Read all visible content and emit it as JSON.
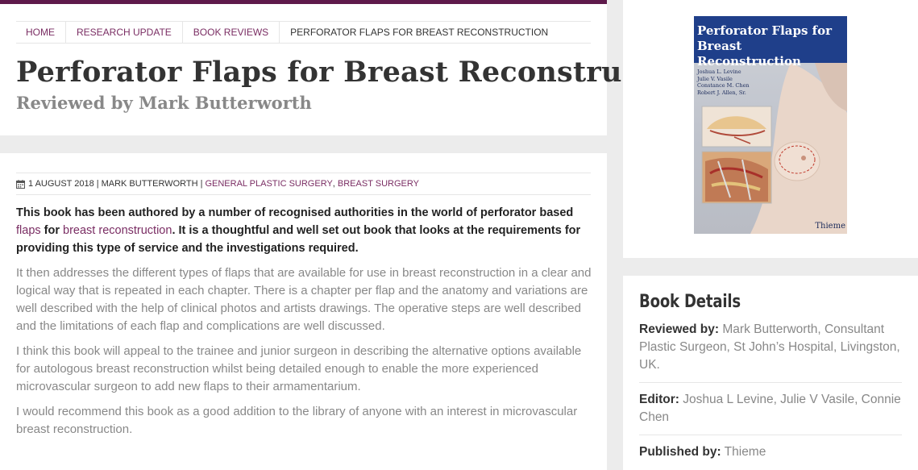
{
  "breadcrumb": {
    "items": [
      "HOME",
      "RESEARCH UPDATE",
      "BOOK REVIEWS"
    ],
    "current": "PERFORATOR FLAPS FOR BREAST RECONSTRUCTION"
  },
  "header": {
    "title": "Perforator Flaps for Breast Reconstruction",
    "subtitle": "Reviewed by Mark Butterworth"
  },
  "meta": {
    "icon": "calendar-icon",
    "date": "1 AUGUST 2018",
    "author": "MARK BUTTERWORTH",
    "categories": [
      "GENERAL PLASTIC SURGERY",
      "BREAST SURGERY"
    ]
  },
  "article": {
    "lead_part1": "This book has been authored by a number of recognised authorities in the world of perforator based ",
    "lead_link1": "flaps",
    "lead_part2": " for ",
    "lead_link2": "breast reconstruction",
    "lead_part3": ". It is a thoughtful and well set out book that looks at the requirements for providing this type of service and the investigations required.",
    "paragraphs": [
      "It then addresses the different types of flaps that are available for use in breast reconstruction in a clear and logical way that is repeated in each chapter. There is a chapter per flap and the anatomy and variations are well described with the help of clinical photos and artists drawings. The operative steps are well described and the limitations of each flap and complications are well discussed.",
      "I think this book will appeal to the trainee and junior surgeon in describing the alternative options available for autologous breast reconstruction whilst being detailed enough to enable the more experienced microvascular surgeon to add new flaps to their armamentarium.",
      "I would recommend this book as a good addition to the library of anyone with an interest in microvascular breast reconstruction."
    ]
  },
  "cover": {
    "title": "Perforator Flaps for Breast Reconstruction",
    "authors": [
      "Joshua L. Levine",
      "Julie V. Vasile",
      "Constance M. Chen",
      "Robert J. Allen, Sr."
    ],
    "publisher": "Thieme"
  },
  "details": {
    "heading": "Book Details",
    "items": [
      {
        "label": "Reviewed by:",
        "value": "Mark Butterworth, Consultant Plastic Surgeon, St John’s Hospital, Livingston, UK."
      },
      {
        "label": "Editor:",
        "value": "Joshua L Levine, Julie V Vasile, Connie Chen"
      },
      {
        "label": "Published by:",
        "value": "Thieme"
      }
    ]
  },
  "colors": {
    "accent": "#7a2d63",
    "top_bar": "#5e1a4b",
    "cover_band": "#1f3f8a"
  }
}
